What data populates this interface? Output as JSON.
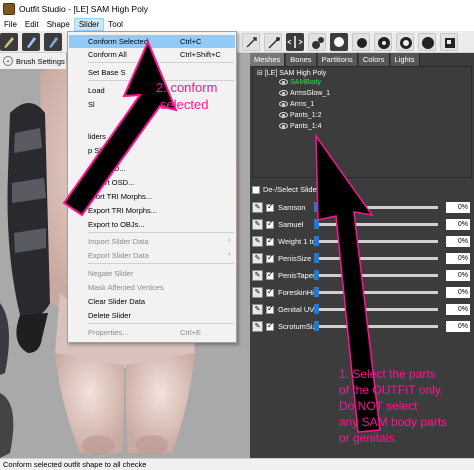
{
  "window": {
    "title": "Outfit Studio - [LE] SAM High Poly"
  },
  "menubar": [
    "File",
    "Edit",
    "Shape",
    "Slider",
    "Tool"
  ],
  "brush_settings_label": "Brush Settings",
  "tabs": [
    "Meshes",
    "Bones",
    "Partitions",
    "Colors",
    "Lights"
  ],
  "mesh_tree": {
    "root": "[LE] SAM High Poly",
    "items": [
      {
        "label": "SAMBody",
        "color": "#00ff33"
      },
      {
        "label": "ArmsGlow_1"
      },
      {
        "label": "Arms_1"
      },
      {
        "label": "Pants_1:2"
      },
      {
        "label": "Pants_1:4"
      }
    ]
  },
  "slider_header": "De-/Select Sliders",
  "sliders": [
    {
      "name": "Samson",
      "value": "0%"
    },
    {
      "name": "Samuel",
      "value": "0%"
    },
    {
      "name": "Weight 1 to",
      "value": "0%"
    },
    {
      "name": "PenisSize",
      "value": "0%"
    },
    {
      "name": "PenisTaper",
      "value": "0%"
    },
    {
      "name": "ForeskinHide",
      "value": "0%"
    },
    {
      "name": "Genital UV",
      "value": "0%"
    },
    {
      "name": "ScrotumSize",
      "value": "0%"
    }
  ],
  "slider_menu": {
    "items": [
      {
        "label": "Conform Selected",
        "shortcut": "Ctrl+C",
        "highlighted": true
      },
      {
        "label": "Conform All",
        "shortcut": "Ctrl+Shift+C"
      },
      {
        "label": "Set Base S"
      },
      {
        "label": "Load"
      },
      {
        "label": "Sl"
      },
      {
        "label": "liders"
      },
      {
        "label": "p Slider"
      },
      {
        "label": "port OSD..."
      },
      {
        "label": "Export OSD..."
      },
      {
        "label": "xport TRI Morphs..."
      },
      {
        "label": "Export TRI Morphs..."
      },
      {
        "label": "Export to OBJs..."
      },
      {
        "label": "Import Slider Data",
        "disabled": true,
        "submenu": true
      },
      {
        "label": "Export Slider Data",
        "disabled": true,
        "submenu": true
      },
      {
        "label": "Negate Slider",
        "disabled": true
      },
      {
        "label": "Mask Affected Vertices",
        "disabled": true
      },
      {
        "label": "Clear Slider Data"
      },
      {
        "label": "Delete Slider"
      },
      {
        "label": "Properties...",
        "disabled": true,
        "shortcut": "Ctrl+E"
      }
    ]
  },
  "status_text": "Conform selected outfit shape to all checke",
  "annotations": {
    "step2_line1": "2. conform",
    "step2_line2": "selected",
    "step1_line1": "1. Select the parts",
    "step1_line2": "of the OUTFIT only.",
    "step1_line3": "Do NOT select",
    "step1_line4": "any SAM body parts",
    "step1_line5": "or genitals.",
    "color": "#ff1493"
  }
}
